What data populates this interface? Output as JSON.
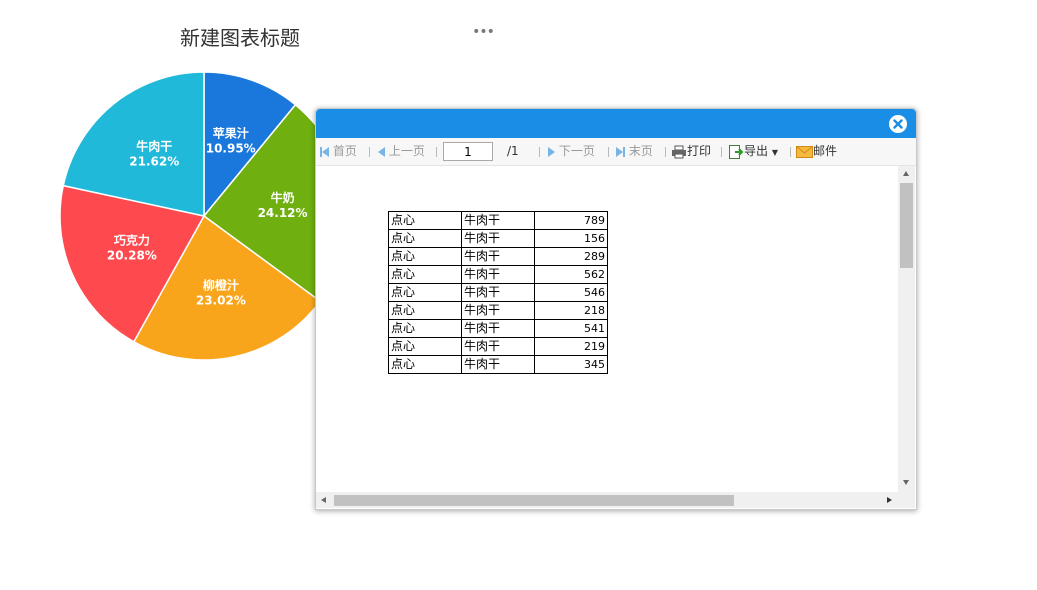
{
  "chart": {
    "title": "新建图表标题",
    "more_label": "•••"
  },
  "chart_data": {
    "type": "pie",
    "title": "新建图表标题",
    "categories": [
      "苹果汁",
      "牛奶",
      "柳橙汁",
      "巧克力",
      "牛肉干"
    ],
    "values": [
      10.95,
      24.12,
      23.02,
      20.28,
      21.62
    ],
    "labels": [
      "10.95%",
      "24.12%",
      "23.02%",
      "20.28%",
      "21.62%"
    ],
    "colors": [
      "#1a78dc",
      "#6fb010",
      "#f8a51c",
      "#fe4a4f",
      "#21b9d9"
    ],
    "colors_light": [
      "#2a8ff0",
      "#8ccf18",
      "#ffb820",
      "#ff5a5e",
      "#1fd0f2"
    ]
  },
  "dialog": {
    "toolbar": {
      "first": "首页",
      "prev": "上一页",
      "page_value": "1",
      "page_total": "/1",
      "next": "下一页",
      "last": "末页",
      "print": "打印",
      "export": "导出",
      "mail": "邮件"
    },
    "table": {
      "rows": [
        [
          "点心",
          "牛肉干",
          "789"
        ],
        [
          "点心",
          "牛肉干",
          "156"
        ],
        [
          "点心",
          "牛肉干",
          "289"
        ],
        [
          "点心",
          "牛肉干",
          "562"
        ],
        [
          "点心",
          "牛肉干",
          "546"
        ],
        [
          "点心",
          "牛肉干",
          "218"
        ],
        [
          "点心",
          "牛肉干",
          "541"
        ],
        [
          "点心",
          "牛肉干",
          "219"
        ],
        [
          "点心",
          "牛肉干",
          "345"
        ]
      ]
    }
  },
  "icons": {
    "close": "close-icon",
    "print": "printer-icon",
    "export": "export-icon",
    "mail": "mail-icon"
  }
}
